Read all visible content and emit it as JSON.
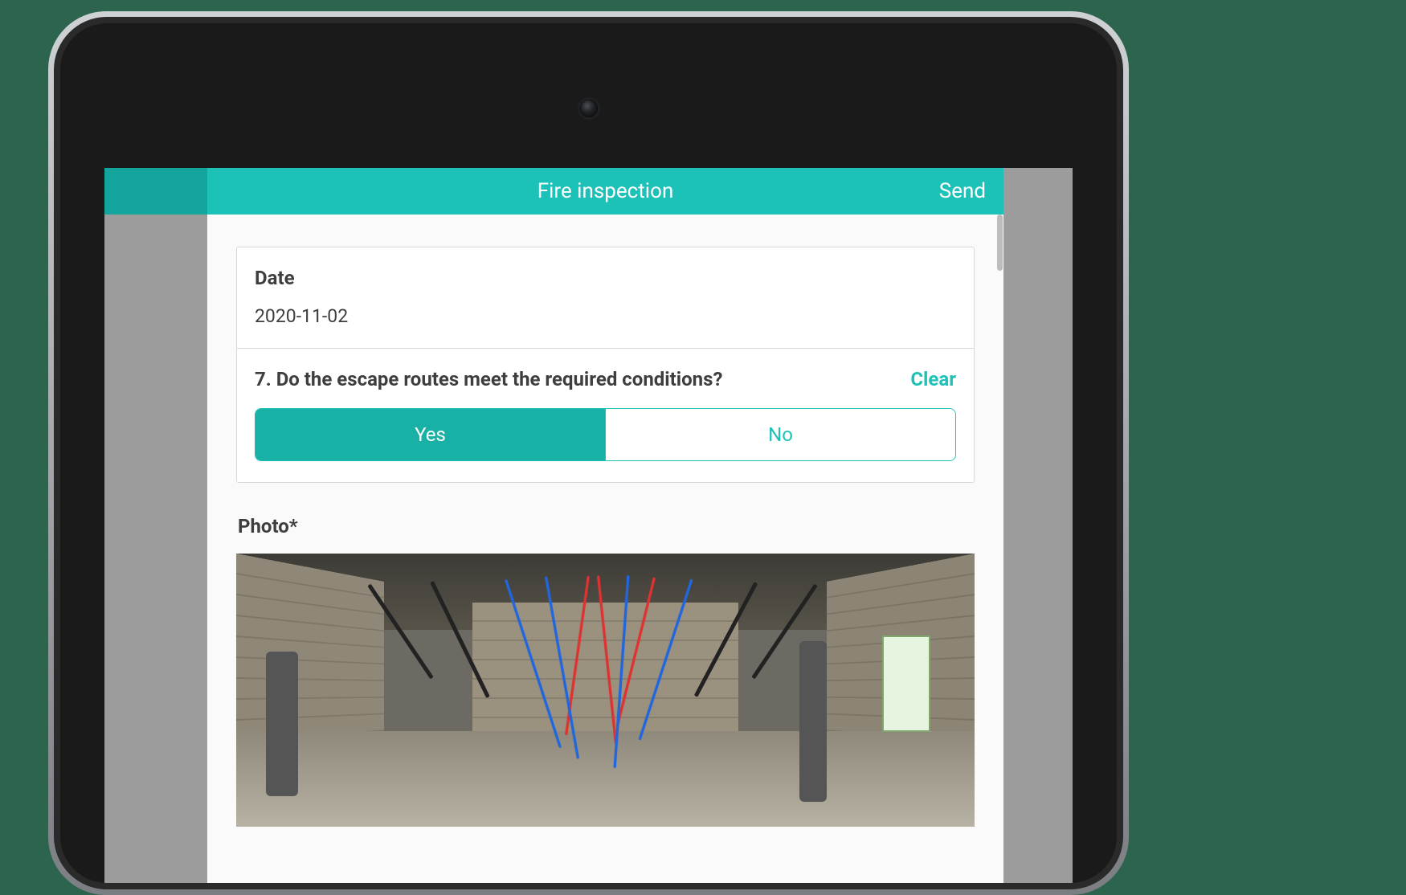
{
  "header": {
    "title": "Fire inspection",
    "send_label": "Send"
  },
  "date_field": {
    "label": "Date",
    "value": "2020-11-02"
  },
  "question": {
    "text": "7. Do the escape routes meet the required conditions?",
    "clear_label": "Clear",
    "options": {
      "yes": "Yes",
      "no": "No"
    },
    "selected": "yes"
  },
  "photo": {
    "label": "Photo*"
  },
  "colors": {
    "accent": "#1cc1b7",
    "accent_dark": "#13a59c"
  }
}
